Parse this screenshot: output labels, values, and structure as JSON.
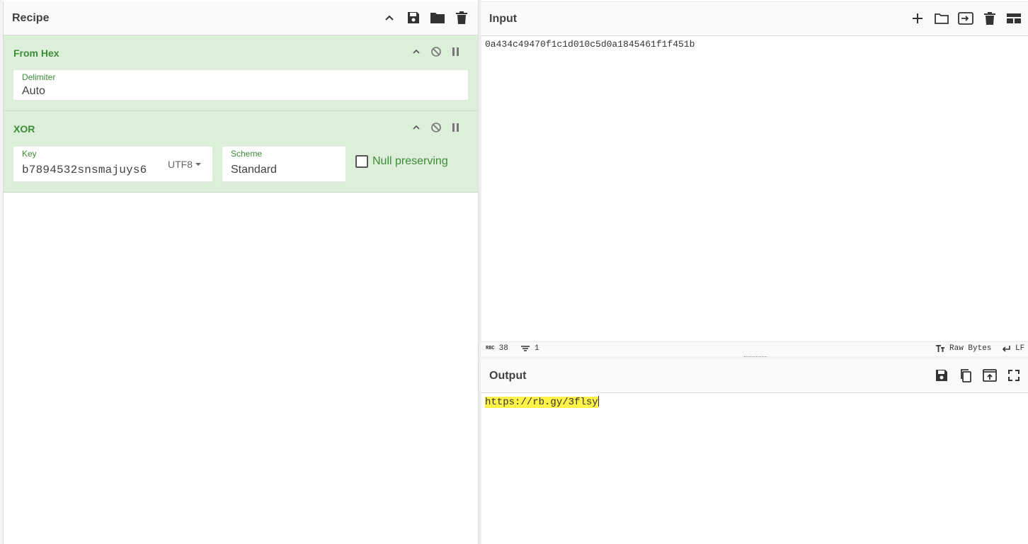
{
  "recipe": {
    "title": "Recipe",
    "operations": [
      {
        "name": "From Hex",
        "args": {
          "delimiter_label": "Delimiter",
          "delimiter_value": "Auto"
        }
      },
      {
        "name": "XOR",
        "args": {
          "key_label": "Key",
          "key_value": "b7894532snsmajuys6",
          "key_encoding": "UTF8",
          "scheme_label": "Scheme",
          "scheme_value": "Standard",
          "null_preserving_label": "Null preserving",
          "null_preserving_checked": false
        }
      }
    ]
  },
  "input": {
    "title": "Input",
    "text": "0a434c49470f1c1d010c5d0a1845461f1f451b",
    "status": {
      "length": "38",
      "lines": "1",
      "encoding": "Raw Bytes",
      "eol": "LF"
    }
  },
  "output": {
    "title": "Output",
    "text": "https://rb.gy/3flsy"
  },
  "colors": {
    "accent_green": "#3d8b37",
    "op_background": "#dcefd9",
    "highlight": "#fff349"
  }
}
